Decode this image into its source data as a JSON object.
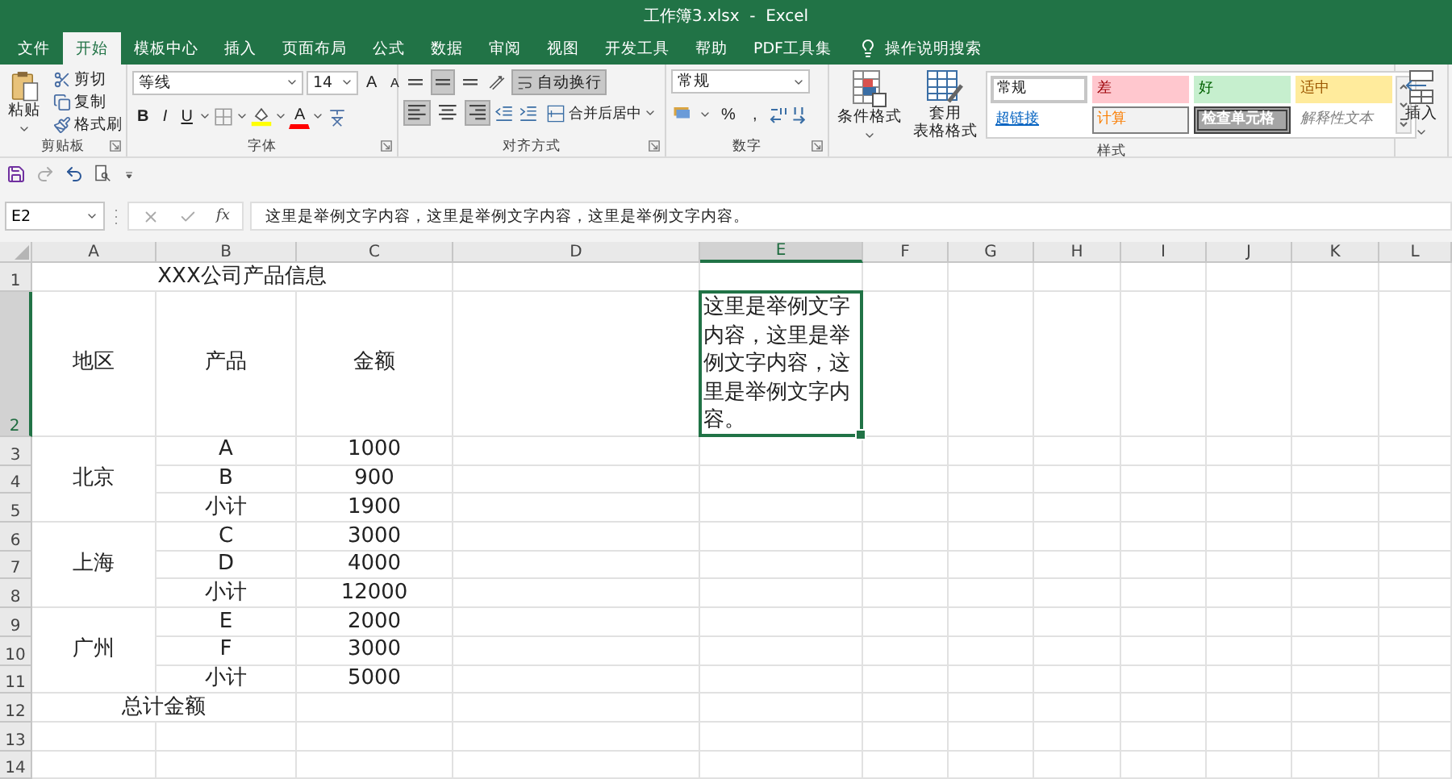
{
  "window": {
    "title": "工作簿3.xlsx  -  Excel"
  },
  "tabs": [
    {
      "label": "文件",
      "selected": false
    },
    {
      "label": "开始",
      "selected": true
    },
    {
      "label": "模板中心",
      "selected": false
    },
    {
      "label": "插入",
      "selected": false
    },
    {
      "label": "页面布局",
      "selected": false
    },
    {
      "label": "公式",
      "selected": false
    },
    {
      "label": "数据",
      "selected": false
    },
    {
      "label": "审阅",
      "selected": false
    },
    {
      "label": "视图",
      "selected": false
    },
    {
      "label": "开发工具",
      "selected": false
    },
    {
      "label": "帮助",
      "selected": false
    },
    {
      "label": "PDF工具集",
      "selected": false
    }
  ],
  "search": {
    "label": "操作说明搜索"
  },
  "ribbon": {
    "clipboard": {
      "label": "剪贴板",
      "paste": "粘贴",
      "items": [
        {
          "label": "剪切",
          "kind": "cut"
        },
        {
          "label": "复制",
          "kind": "copy"
        },
        {
          "label": "格式刷",
          "kind": "painter"
        }
      ]
    },
    "font": {
      "label": "字体",
      "font_name": "等线",
      "font_size": "14",
      "grow": "A",
      "shrink": "A",
      "styles": [
        {
          "label": "B",
          "kind": "bold"
        },
        {
          "label": "I",
          "kind": "italic"
        },
        {
          "label": "U",
          "kind": "underline"
        }
      ],
      "font_color": "A"
    },
    "alignment": {
      "label": "对齐方式",
      "buttons": [
        {
          "kind": "top",
          "pressed": false
        },
        {
          "kind": "middle",
          "pressed": true
        },
        {
          "kind": "bottom",
          "pressed": false
        },
        {
          "kind": "left",
          "pressed": true
        },
        {
          "kind": "center",
          "pressed": false
        },
        {
          "kind": "right",
          "pressed": true
        }
      ],
      "wrap_text": {
        "label": "自动换行",
        "pressed": true
      },
      "merge": "合并后居中"
    },
    "number": {
      "label": "数字",
      "format": "常规",
      "percent": "%",
      "comma": ","
    },
    "styles": {
      "label": "样式",
      "conditional": "条件格式",
      "table_format": [
        "套用",
        "表格格式"
      ],
      "gallery": [
        {
          "label": "常规",
          "kind": "normal"
        },
        {
          "label": "差",
          "kind": "bad"
        },
        {
          "label": "好",
          "kind": "good"
        },
        {
          "label": "适中",
          "kind": "neutral"
        },
        {
          "label": "超链接",
          "kind": "hyperlink"
        },
        {
          "label": "计算",
          "kind": "calculation"
        },
        {
          "label": "检查单元格",
          "kind": "check"
        },
        {
          "label": "解释性文本",
          "kind": "explanatory"
        }
      ]
    },
    "cells": {
      "insert": "插入"
    }
  },
  "formula_bar": {
    "name_box": "E2",
    "function_button": "fx",
    "formula": "这里是举例文字内容，这里是举例文字内容，这里是举例文字内容。"
  },
  "sheet": {
    "columns": [
      {
        "label": "A",
        "selected": false
      },
      {
        "label": "B",
        "selected": false
      },
      {
        "label": "C",
        "selected": false
      },
      {
        "label": "D",
        "selected": false
      },
      {
        "label": "E",
        "selected": true
      },
      {
        "label": "F",
        "selected": false
      },
      {
        "label": "G",
        "selected": false
      },
      {
        "label": "H",
        "selected": false
      },
      {
        "label": "I",
        "selected": false
      },
      {
        "label": "J",
        "selected": false
      },
      {
        "label": "K",
        "selected": false
      },
      {
        "label": "L",
        "selected": false
      }
    ],
    "rows": [
      {
        "label": "1",
        "selected": false
      },
      {
        "label": "2",
        "selected": true
      },
      {
        "label": "3",
        "selected": false
      },
      {
        "label": "4",
        "selected": false
      },
      {
        "label": "5",
        "selected": false
      },
      {
        "label": "6",
        "selected": false
      },
      {
        "label": "7",
        "selected": false
      },
      {
        "label": "8",
        "selected": false
      },
      {
        "label": "9",
        "selected": false
      },
      {
        "label": "10",
        "selected": false
      },
      {
        "label": "11",
        "selected": false
      },
      {
        "label": "12",
        "selected": false
      },
      {
        "label": "13",
        "selected": false
      },
      {
        "label": "14",
        "selected": false
      }
    ],
    "title": "XXX公司产品信息",
    "headers": [
      "地区",
      "产品",
      "金额"
    ],
    "regions": [
      {
        "name": "北京",
        "items": [
          {
            "product": "A",
            "amount": "1000"
          },
          {
            "product": "B",
            "amount": "900"
          },
          {
            "product": "小计",
            "amount": "1900"
          }
        ]
      },
      {
        "name": "上海",
        "items": [
          {
            "product": "C",
            "amount": "3000"
          },
          {
            "product": "D",
            "amount": "4000"
          },
          {
            "product": "小计",
            "amount": "12000"
          }
        ]
      },
      {
        "name": "广州",
        "items": [
          {
            "product": "E",
            "amount": "2000"
          },
          {
            "product": "F",
            "amount": "3000"
          },
          {
            "product": "小计",
            "amount": "5000"
          }
        ]
      }
    ],
    "total_label": "总计金额",
    "active_cell": "这里是举例文字内容，这里是举例文字内容，这里是举例文字内容。"
  }
}
